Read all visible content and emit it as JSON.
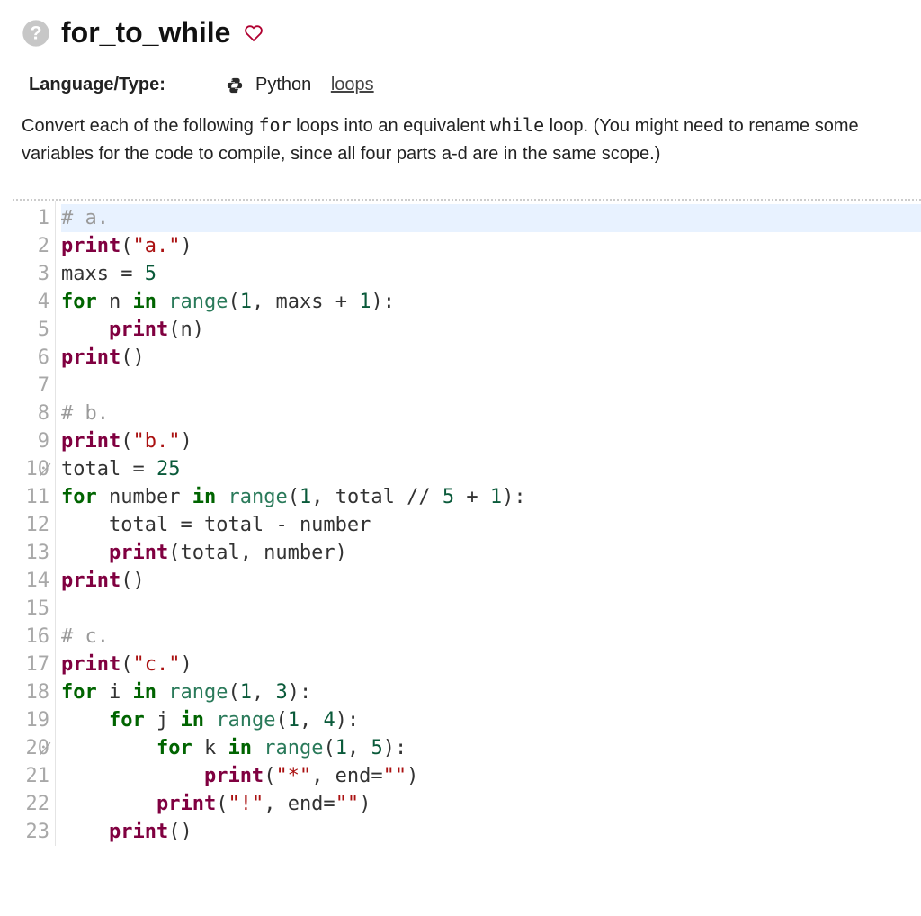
{
  "header": {
    "title": "for_to_while"
  },
  "meta": {
    "label": "Language/Type:",
    "language": "Python",
    "tag": "loops"
  },
  "description": {
    "pre": "Convert each of the following ",
    "code1": "for",
    "mid": " loops into an equivalent ",
    "code2": "while",
    "post": " loop. (You might need to rename some variables for the code to compile, since all four parts a-d are in the same scope.)"
  },
  "code": {
    "lines": [
      {
        "n": "1",
        "tokens": [
          {
            "t": "# a.",
            "c": "cm"
          }
        ],
        "hl": true
      },
      {
        "n": "2",
        "tokens": [
          {
            "t": "print",
            "c": "fn"
          },
          {
            "t": "(",
            "c": "op"
          },
          {
            "t": "\"a.\"",
            "c": "str"
          },
          {
            "t": ")",
            "c": "op"
          }
        ]
      },
      {
        "n": "3",
        "tokens": [
          {
            "t": "maxs ",
            "c": "id"
          },
          {
            "t": "= ",
            "c": "op"
          },
          {
            "t": "5",
            "c": "num"
          }
        ]
      },
      {
        "n": "4",
        "tokens": [
          {
            "t": "for",
            "c": "kw"
          },
          {
            "t": " n ",
            "c": "id"
          },
          {
            "t": "in",
            "c": "kw"
          },
          {
            "t": " ",
            "c": "id"
          },
          {
            "t": "range",
            "c": "fnl"
          },
          {
            "t": "(",
            "c": "op"
          },
          {
            "t": "1",
            "c": "num"
          },
          {
            "t": ", maxs ",
            "c": "id"
          },
          {
            "t": "+ ",
            "c": "op"
          },
          {
            "t": "1",
            "c": "num"
          },
          {
            "t": "):",
            "c": "op"
          }
        ]
      },
      {
        "n": "5",
        "tokens": [
          {
            "t": "    ",
            "c": "id"
          },
          {
            "t": "print",
            "c": "fn"
          },
          {
            "t": "(n)",
            "c": "op"
          }
        ]
      },
      {
        "n": "6",
        "tokens": [
          {
            "t": "print",
            "c": "fn"
          },
          {
            "t": "()",
            "c": "op"
          }
        ]
      },
      {
        "n": "7",
        "tokens": []
      },
      {
        "n": "8",
        "tokens": [
          {
            "t": "# b.",
            "c": "cm"
          }
        ]
      },
      {
        "n": "9",
        "tokens": [
          {
            "t": "print",
            "c": "fn"
          },
          {
            "t": "(",
            "c": "op"
          },
          {
            "t": "\"b.\"",
            "c": "str"
          },
          {
            "t": ")",
            "c": "op"
          }
        ]
      },
      {
        "n": "10",
        "tokens": [
          {
            "t": "total ",
            "c": "id"
          },
          {
            "t": "= ",
            "c": "op"
          },
          {
            "t": "25",
            "c": "num"
          }
        ]
      },
      {
        "n": "11",
        "tokens": [
          {
            "t": "for",
            "c": "kw"
          },
          {
            "t": " number ",
            "c": "id"
          },
          {
            "t": "in",
            "c": "kw"
          },
          {
            "t": " ",
            "c": "id"
          },
          {
            "t": "range",
            "c": "fnl"
          },
          {
            "t": "(",
            "c": "op"
          },
          {
            "t": "1",
            "c": "num"
          },
          {
            "t": ", total ",
            "c": "id"
          },
          {
            "t": "// ",
            "c": "op"
          },
          {
            "t": "5",
            "c": "num"
          },
          {
            "t": " ",
            "c": "id"
          },
          {
            "t": "+ ",
            "c": "op"
          },
          {
            "t": "1",
            "c": "num"
          },
          {
            "t": "):",
            "c": "op"
          }
        ]
      },
      {
        "n": "12",
        "tokens": [
          {
            "t": "    total ",
            "c": "id"
          },
          {
            "t": "= ",
            "c": "op"
          },
          {
            "t": "total ",
            "c": "id"
          },
          {
            "t": "- ",
            "c": "op"
          },
          {
            "t": "number",
            "c": "id"
          }
        ]
      },
      {
        "n": "13",
        "tokens": [
          {
            "t": "    ",
            "c": "id"
          },
          {
            "t": "print",
            "c": "fn"
          },
          {
            "t": "(total, number)",
            "c": "op"
          }
        ]
      },
      {
        "n": "14",
        "tokens": [
          {
            "t": "print",
            "c": "fn"
          },
          {
            "t": "()",
            "c": "op"
          }
        ]
      },
      {
        "n": "15",
        "tokens": []
      },
      {
        "n": "16",
        "tokens": [
          {
            "t": "# c.",
            "c": "cm"
          }
        ]
      },
      {
        "n": "17",
        "tokens": [
          {
            "t": "print",
            "c": "fn"
          },
          {
            "t": "(",
            "c": "op"
          },
          {
            "t": "\"c.\"",
            "c": "str"
          },
          {
            "t": ")",
            "c": "op"
          }
        ]
      },
      {
        "n": "18",
        "tokens": [
          {
            "t": "for",
            "c": "kw"
          },
          {
            "t": " i ",
            "c": "id"
          },
          {
            "t": "in",
            "c": "kw"
          },
          {
            "t": " ",
            "c": "id"
          },
          {
            "t": "range",
            "c": "fnl"
          },
          {
            "t": "(",
            "c": "op"
          },
          {
            "t": "1",
            "c": "num"
          },
          {
            "t": ", ",
            "c": "op"
          },
          {
            "t": "3",
            "c": "num"
          },
          {
            "t": "):",
            "c": "op"
          }
        ]
      },
      {
        "n": "19",
        "tokens": [
          {
            "t": "    ",
            "c": "id"
          },
          {
            "t": "for",
            "c": "kw"
          },
          {
            "t": " j ",
            "c": "id"
          },
          {
            "t": "in",
            "c": "kw"
          },
          {
            "t": " ",
            "c": "id"
          },
          {
            "t": "range",
            "c": "fnl"
          },
          {
            "t": "(",
            "c": "op"
          },
          {
            "t": "1",
            "c": "num"
          },
          {
            "t": ", ",
            "c": "op"
          },
          {
            "t": "4",
            "c": "num"
          },
          {
            "t": "):",
            "c": "op"
          }
        ]
      },
      {
        "n": "20",
        "tokens": [
          {
            "t": "        ",
            "c": "id"
          },
          {
            "t": "for",
            "c": "kw"
          },
          {
            "t": " k ",
            "c": "id"
          },
          {
            "t": "in",
            "c": "kw"
          },
          {
            "t": " ",
            "c": "id"
          },
          {
            "t": "range",
            "c": "fnl"
          },
          {
            "t": "(",
            "c": "op"
          },
          {
            "t": "1",
            "c": "num"
          },
          {
            "t": ", ",
            "c": "op"
          },
          {
            "t": "5",
            "c": "num"
          },
          {
            "t": "):",
            "c": "op"
          }
        ]
      },
      {
        "n": "21",
        "tokens": [
          {
            "t": "            ",
            "c": "id"
          },
          {
            "t": "print",
            "c": "fn"
          },
          {
            "t": "(",
            "c": "op"
          },
          {
            "t": "\"*\"",
            "c": "str"
          },
          {
            "t": ", end=",
            "c": "op"
          },
          {
            "t": "\"\"",
            "c": "str"
          },
          {
            "t": ")",
            "c": "op"
          }
        ]
      },
      {
        "n": "22",
        "tokens": [
          {
            "t": "        ",
            "c": "id"
          },
          {
            "t": "print",
            "c": "fn"
          },
          {
            "t": "(",
            "c": "op"
          },
          {
            "t": "\"!\"",
            "c": "str"
          },
          {
            "t": ", end=",
            "c": "op"
          },
          {
            "t": "\"\"",
            "c": "str"
          },
          {
            "t": ")",
            "c": "op"
          }
        ]
      },
      {
        "n": "23",
        "tokens": [
          {
            "t": "    ",
            "c": "id"
          },
          {
            "t": "print",
            "c": "fn"
          },
          {
            "t": "()",
            "c": "op"
          }
        ]
      }
    ]
  }
}
